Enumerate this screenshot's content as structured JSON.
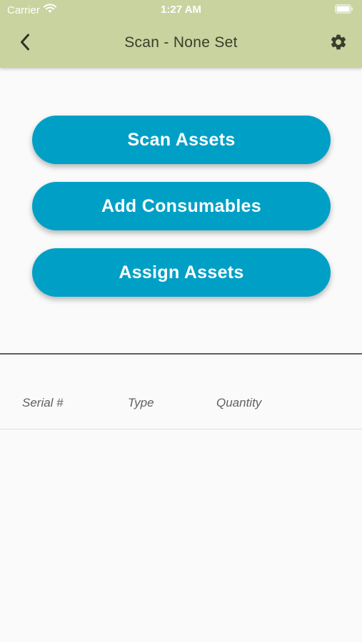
{
  "status_bar": {
    "carrier": "Carrier",
    "time": "1:27 AM"
  },
  "header": {
    "title": "Scan - None Set",
    "back_icon": "chevron-left-icon",
    "settings_icon": "gear-icon",
    "background_color": "#c8d39f"
  },
  "actions": {
    "scan_assets": "Scan Assets",
    "add_consumables": "Add Consumables",
    "assign_assets": "Assign Assets",
    "button_color": "#00a0c6"
  },
  "table": {
    "columns": [
      "Serial #",
      "Type",
      "Quantity"
    ],
    "rows": []
  }
}
